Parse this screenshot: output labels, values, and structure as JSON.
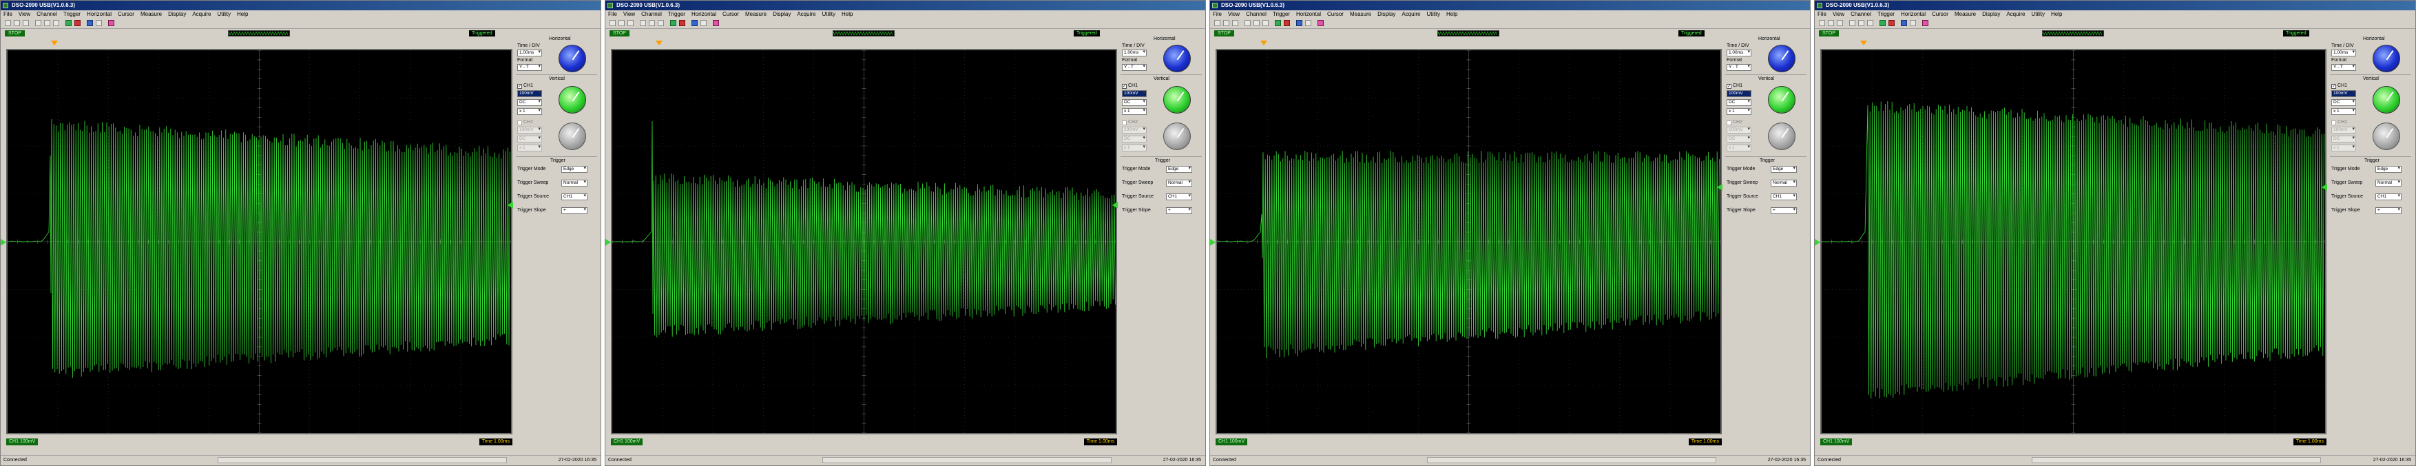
{
  "windows": [
    {
      "title": "DSO-2090 USB(V1.0.6.3)",
      "menu": [
        "File",
        "View",
        "Channel",
        "Trigger",
        "Horizontal",
        "Cursor",
        "Measure",
        "Display",
        "Acquire",
        "Utility",
        "Help"
      ],
      "state_badge": "STOP",
      "trigger_status": "Triggered",
      "ch1_readout": "CH1 100mV",
      "time_readout": "Time 1.00ms",
      "status_left": "Connected",
      "status_right": "27-02-2020 16:35",
      "horizontal_title": "Horizontal",
      "time_div_label": "Time / DIV",
      "time_div_value": "1.00ms",
      "format_label": "Format",
      "format_value": "Y - T",
      "vertical_title": "Vertical",
      "ch1_label": "CH1",
      "ch1_volts": "100mV",
      "ch1_coupling": "DC",
      "ch1_probe": "x 1",
      "ch2_label": "CH2",
      "ch2_volts": "100mV",
      "ch2_coupling": "DC",
      "ch2_probe": "x 1",
      "trigger_title": "Trigger",
      "trigger_mode_label": "Trigger Mode",
      "trigger_mode_value": "Edge",
      "trigger_sweep_label": "Trigger Sweep",
      "trigger_sweep_value": "Normal",
      "trigger_source_label": "Trigger Source",
      "trigger_source_value": "CH1",
      "trigger_slope_label": "Trigger Slope",
      "trigger_slope_value": "+"
    },
    {
      "title": "DSO-2090 USB(V1.0.6.3)",
      "menu": [
        "File",
        "View",
        "Channel",
        "Trigger",
        "Horizontal",
        "Cursor",
        "Measure",
        "Display",
        "Acquire",
        "Utility",
        "Help"
      ],
      "state_badge": "STOP",
      "trigger_status": "Triggered",
      "ch1_readout": "CH1 100mV",
      "time_readout": "Time 1.00ms",
      "status_left": "Connected",
      "status_right": "27-02-2020 16:35",
      "horizontal_title": "Horizontal",
      "time_div_label": "Time / DIV",
      "time_div_value": "1.00ms",
      "format_label": "Format",
      "format_value": "Y - T",
      "vertical_title": "Vertical",
      "ch1_label": "CH1",
      "ch1_volts": "100mV",
      "ch1_coupling": "DC",
      "ch1_probe": "x 1",
      "ch2_label": "CH2",
      "ch2_volts": "100mV",
      "ch2_coupling": "DC",
      "ch2_probe": "x 1",
      "trigger_title": "Trigger",
      "trigger_mode_label": "Trigger Mode",
      "trigger_mode_value": "Edge",
      "trigger_sweep_label": "Trigger Sweep",
      "trigger_sweep_value": "Normal",
      "trigger_source_label": "Trigger Source",
      "trigger_source_value": "CH1",
      "trigger_slope_label": "Trigger Slope",
      "trigger_slope_value": "+"
    },
    {
      "title": "DSO-2090 USB(V1.0.6.3)",
      "menu": [
        "File",
        "View",
        "Channel",
        "Trigger",
        "Horizontal",
        "Cursor",
        "Measure",
        "Display",
        "Acquire",
        "Utility",
        "Help"
      ],
      "state_badge": "STOP",
      "trigger_status": "Triggered",
      "ch1_readout": "CH1 100mV",
      "time_readout": "Time 1.00ms",
      "status_left": "Connected",
      "status_right": "27-02-2020 16:35",
      "horizontal_title": "Horizontal",
      "time_div_label": "Time / DIV",
      "time_div_value": "1.00ms",
      "format_label": "Format",
      "format_value": "Y - T",
      "vertical_title": "Vertical",
      "ch1_label": "CH1",
      "ch1_volts": "100mV",
      "ch1_coupling": "DC",
      "ch1_probe": "x 1",
      "ch2_label": "CH2",
      "ch2_volts": "100mV",
      "ch2_coupling": "DC",
      "ch2_probe": "x 1",
      "trigger_title": "Trigger",
      "trigger_mode_label": "Trigger Mode",
      "trigger_mode_value": "Edge",
      "trigger_sweep_label": "Trigger Sweep",
      "trigger_sweep_value": "Normal",
      "trigger_source_label": "Trigger Source",
      "trigger_source_value": "CH1",
      "trigger_slope_label": "Trigger Slope",
      "trigger_slope_value": "+"
    },
    {
      "title": "DSO-2090 USB(V1.0.6.3)",
      "menu": [
        "File",
        "View",
        "Channel",
        "Trigger",
        "Horizontal",
        "Cursor",
        "Measure",
        "Display",
        "Acquire",
        "Utility",
        "Help"
      ],
      "state_badge": "STOP",
      "trigger_status": "Triggered",
      "ch1_readout": "CH1 100mV",
      "time_readout": "Time 1.00ms",
      "status_left": "Connected",
      "status_right": "27-02-2020 16:35",
      "horizontal_title": "Horizontal",
      "time_div_label": "Time / DIV",
      "time_div_value": "1.00ms",
      "format_label": "Format",
      "format_value": "Y - T",
      "vertical_title": "Vertical",
      "ch1_label": "CH1",
      "ch1_volts": "100mV",
      "ch1_coupling": "DC",
      "ch1_probe": "x 1",
      "ch2_label": "CH2",
      "ch2_volts": "100mV",
      "ch2_coupling": "DC",
      "ch2_probe": "x 1",
      "trigger_title": "Trigger",
      "trigger_mode_label": "Trigger Mode",
      "trigger_mode_value": "Edge",
      "trigger_sweep_label": "Trigger Sweep",
      "trigger_sweep_value": "Normal",
      "trigger_source_label": "Trigger Source",
      "trigger_source_value": "CH1",
      "trigger_slope_label": "Trigger Slope",
      "trigger_slope_value": "+"
    }
  ],
  "colors": {
    "trace": "#33e033",
    "screen": "#000000",
    "grid": "#3a3a3a",
    "trigger_marker": "#ff9c00"
  },
  "icons": [
    "open-icon",
    "save-icon",
    "print-icon",
    "zoom-in-icon",
    "zoom-out-icon",
    "cursor-icon",
    "run-icon",
    "stop-icon",
    "channel-icon",
    "settings-icon",
    "color-icon"
  ]
}
